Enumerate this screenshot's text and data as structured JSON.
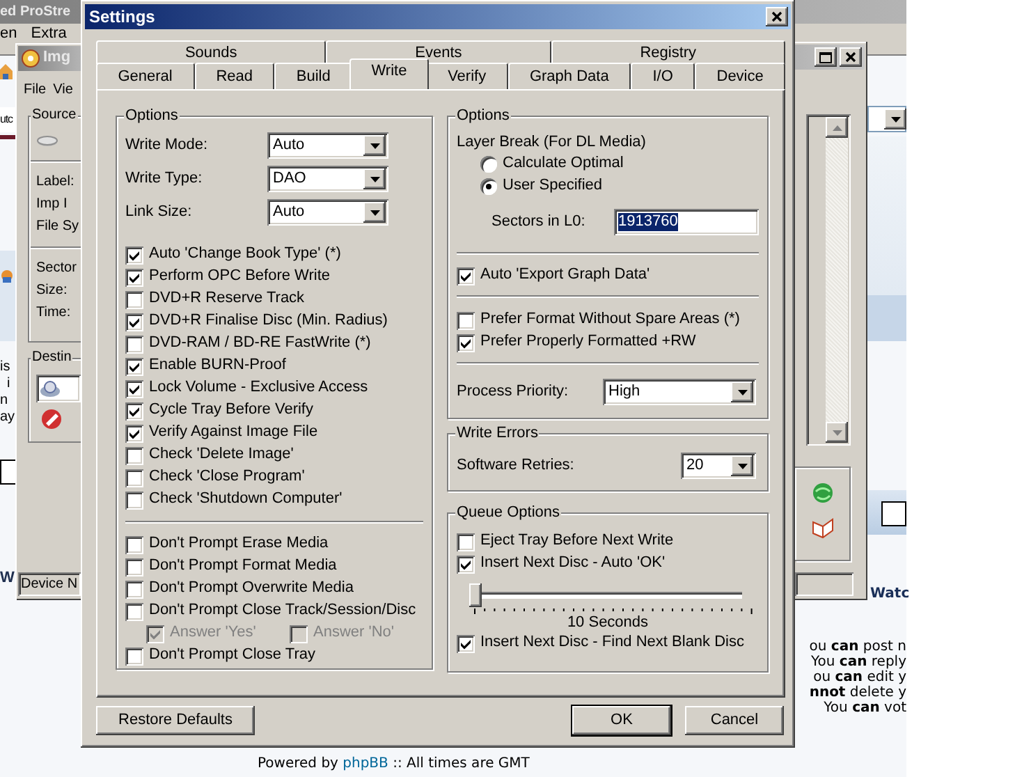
{
  "browser_window": {
    "title": "ed ProStre",
    "menu": [
      "en",
      "Extra"
    ],
    "address": "utc",
    "page_fragments": [
      "is",
      "i",
      "n",
      "ay"
    ],
    "heading_fragment": "W",
    "watch_link": "Watc",
    "permissions": [
      "ou **can** post n",
      "You **can** reply",
      "ou **can** edit y",
      "**nnot** delete y",
      "You **can** vot"
    ],
    "footer": {
      "before": "Powered by ",
      "link": "phpBB",
      "after": " :: All times are GMT"
    }
  },
  "imgburn_window": {
    "title": "Img",
    "menu": [
      "File",
      "Vie"
    ],
    "source": {
      "title": "Source",
      "labels": [
        "Label:",
        "Imp I",
        "File Sy"
      ],
      "labels_2": [
        "Sector",
        "Size:",
        "Time:"
      ]
    },
    "destination": {
      "title": "Destin"
    },
    "status": "Device N"
  },
  "settings_dialog": {
    "title": "Settings",
    "tab_rows": [
      [
        {
          "label": "Sounds",
          "selected": false
        },
        {
          "label": "Events",
          "selected": false
        },
        {
          "label": "Registry",
          "selected": false
        }
      ],
      [
        {
          "label": "General",
          "selected": false
        },
        {
          "label": "Read",
          "selected": false
        },
        {
          "label": "Build",
          "selected": false
        },
        {
          "label": "Write",
          "selected": true
        },
        {
          "label": "Verify",
          "selected": false
        },
        {
          "label": "Graph Data",
          "selected": false
        },
        {
          "label": "I/O",
          "selected": false
        },
        {
          "label": "Device",
          "selected": false
        }
      ]
    ],
    "options": {
      "title": "Options",
      "dropdowns": [
        {
          "label": "Write Mode:",
          "value": "Auto"
        },
        {
          "label": "Write Type:",
          "value": "DAO"
        },
        {
          "label": "Link Size:",
          "value": "Auto"
        }
      ],
      "checkboxes": [
        {
          "label": "Auto 'Change Book Type' (*)",
          "checked": true
        },
        {
          "label": "Perform OPC Before Write",
          "checked": true
        },
        {
          "label": "DVD+R Reserve Track",
          "checked": false
        },
        {
          "label": "DVD+R Finalise Disc (Min. Radius)",
          "checked": true
        },
        {
          "label": "DVD-RAM / BD-RE FastWrite (*)",
          "checked": false
        },
        {
          "label": "Enable BURN-Proof",
          "checked": true
        },
        {
          "label": "Lock Volume - Exclusive Access",
          "checked": true
        },
        {
          "label": "Cycle Tray Before Verify",
          "checked": true
        },
        {
          "label": "Verify Against Image File",
          "checked": true
        },
        {
          "label": "Check 'Delete Image'",
          "checked": false
        },
        {
          "label": "Check 'Close Program'",
          "checked": false
        },
        {
          "label": "Check 'Shutdown Computer'",
          "checked": false
        }
      ],
      "prompt_checkboxes": [
        {
          "label": "Don't Prompt Erase Media",
          "checked": false
        },
        {
          "label": "Don't Prompt Format Media",
          "checked": false
        },
        {
          "label": "Don't Prompt Overwrite Media",
          "checked": false
        },
        {
          "label": "Don't Prompt Close Track/Session/Disc",
          "checked": false
        }
      ],
      "answers": [
        {
          "label": "Answer 'Yes'",
          "checked": true,
          "disabled": true
        },
        {
          "label": "Answer 'No'",
          "checked": false,
          "disabled": true
        }
      ],
      "last_checkboxes": [
        {
          "label": "Don't Prompt Close Tray",
          "checked": false
        }
      ]
    },
    "layer_options": {
      "title": "Options",
      "layer_break_label": "Layer Break (For DL Media)",
      "radios": [
        {
          "label": "Calculate Optimal",
          "selected": false
        },
        {
          "label": "User Specified",
          "selected": true
        }
      ],
      "sectors": {
        "label": "Sectors in L0:",
        "value": "1913760",
        "highlighted": true
      },
      "export_checkboxes": [
        {
          "label": "Auto 'Export Graph Data'",
          "checked": true
        }
      ],
      "format_checkboxes": [
        {
          "label": "Prefer Format Without Spare Areas (*)",
          "checked": false
        },
        {
          "label": "Prefer Properly Formatted +RW",
          "checked": true
        }
      ],
      "priority": {
        "label": "Process Priority:",
        "value": "High"
      }
    },
    "write_errors": {
      "title": "Write Errors",
      "retries": {
        "label": "Software Retries:",
        "value": "20"
      }
    },
    "queue_options": {
      "title": "Queue Options",
      "checkboxes": [
        {
          "label": "Eject Tray Before Next Write",
          "checked": false
        },
        {
          "label": "Insert Next Disc - Auto 'OK'",
          "checked": true
        }
      ],
      "delay": {
        "level": 0,
        "reading": "10 Seconds"
      },
      "after_checkboxes": [
        {
          "label": "Insert Next Disc - Find Next Blank Disc",
          "checked": true
        }
      ]
    },
    "buttons": [
      {
        "label": "Restore Defaults",
        "default": false
      },
      {
        "label": "OK",
        "default": true
      },
      {
        "label": "Cancel",
        "default": false
      }
    ]
  }
}
